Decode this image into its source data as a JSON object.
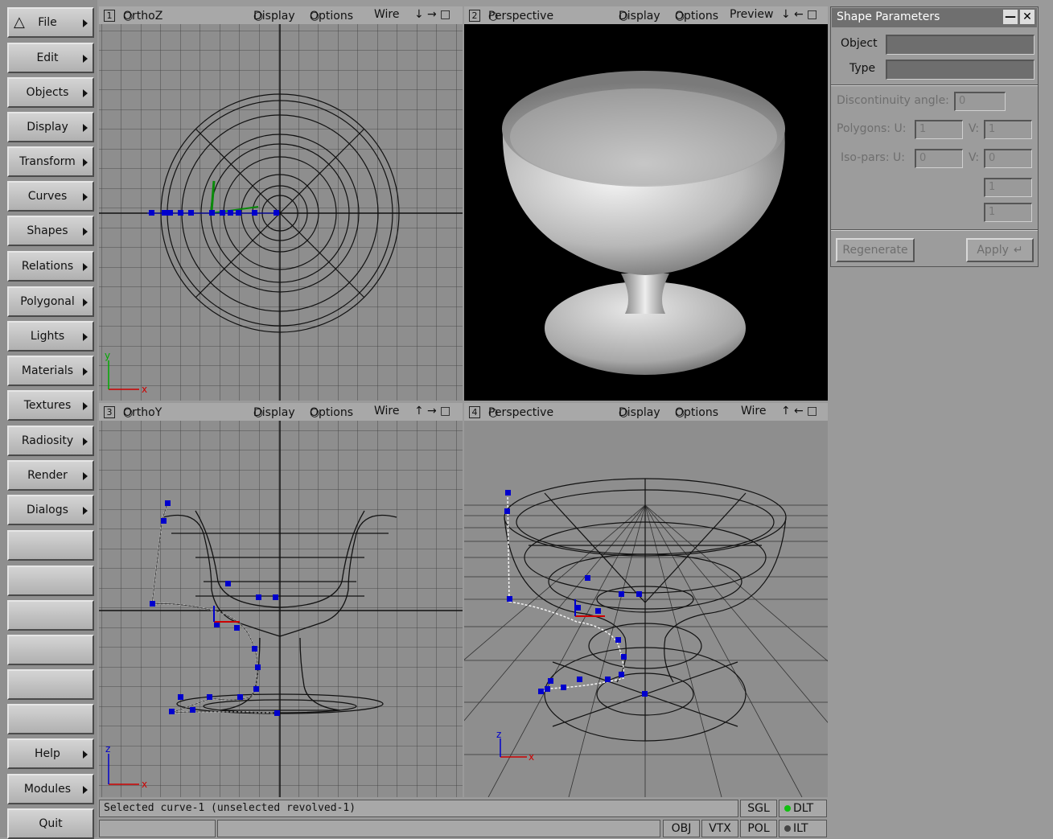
{
  "menu": {
    "items": [
      {
        "label": "File"
      },
      {
        "label": "Edit"
      },
      {
        "label": "Objects"
      },
      {
        "label": "Display"
      },
      {
        "label": "Transform"
      },
      {
        "label": "Curves"
      },
      {
        "label": "Shapes"
      },
      {
        "label": "Relations"
      },
      {
        "label": "Polygonal"
      },
      {
        "label": "Lights"
      },
      {
        "label": "Materials"
      },
      {
        "label": "Textures"
      },
      {
        "label": "Radiosity"
      },
      {
        "label": "Render"
      },
      {
        "label": "Dialogs"
      }
    ],
    "help": "Help",
    "modules": "Modules",
    "quit": "Quit"
  },
  "viewports": {
    "v1": {
      "num": "1",
      "name": "OrthoZ",
      "display": "Display",
      "options": "Options",
      "mode": "Wire"
    },
    "v2": {
      "num": "2",
      "name": "Perspective",
      "display": "Display",
      "options": "Options",
      "mode": "Preview"
    },
    "v3": {
      "num": "3",
      "name": "OrthoY",
      "display": "Display",
      "options": "Options",
      "mode": "Wire"
    },
    "v4": {
      "num": "4",
      "name": "Perspective",
      "display": "Display",
      "options": "Options",
      "mode": "Wire"
    }
  },
  "axes": {
    "x": "x",
    "y": "y",
    "z": "z"
  },
  "panel": {
    "title": "Shape Parameters",
    "object_label": "Object",
    "type_label": "Type",
    "object_value": "",
    "type_value": "",
    "disc_label": "Discontinuity angle:",
    "disc_value": "0",
    "polygons_label": "Polygons: U:",
    "polygons_u": "1",
    "v_label": "V:",
    "polygons_v": "1",
    "isopars_label": "Iso-pars: U:",
    "isopars_u": "0",
    "isopars_v": "0",
    "extra1": "1",
    "extra2": "1",
    "regenerate": "Regenerate",
    "apply": "Apply"
  },
  "status": {
    "message": "Selected curve-1 (unselected revolved-1)",
    "sgl": "SGL",
    "dlt": "DLT",
    "obj": "OBJ",
    "vtx": "VTX",
    "pol": "POL",
    "ilt": "ILT"
  },
  "colors": {
    "handles": "#0000cc",
    "green_dot": "#10c010"
  }
}
